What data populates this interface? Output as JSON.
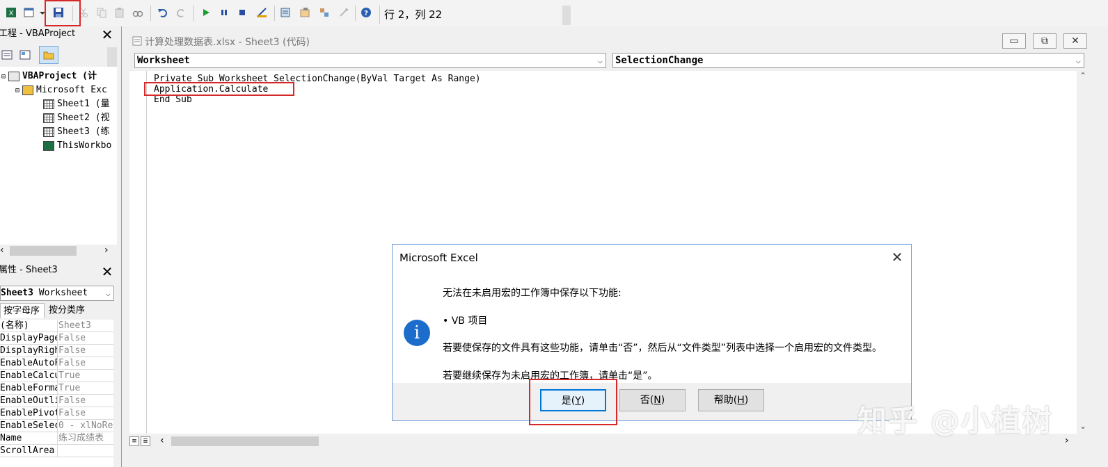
{
  "toolbar": {
    "position_text": "行 2，列 22",
    "icons": [
      "excel-icon",
      "insert-userform-icon",
      "save-icon",
      "cut-icon",
      "copy-icon",
      "paste-icon",
      "find-icon",
      "undo-icon",
      "redo-icon",
      "run-icon",
      "break-icon",
      "reset-icon",
      "design-mode-icon",
      "project-explorer-icon",
      "properties-icon",
      "object-browser-icon",
      "toolbox-icon",
      "help-icon"
    ]
  },
  "project": {
    "title": "工程 - VBAProject",
    "tree": [
      {
        "label": "VBAProject (计"
      },
      {
        "label": "Microsoft Exc"
      },
      {
        "label": "Sheet1 (量"
      },
      {
        "label": "Sheet2 (视"
      },
      {
        "label": "Sheet3 (练"
      },
      {
        "label": "ThisWorkbo"
      }
    ]
  },
  "properties": {
    "title": "属性 - Sheet3",
    "object_name": "Sheet3",
    "object_type": "Worksheet",
    "tabs": [
      "按字母序",
      "按分类序"
    ],
    "rows": [
      {
        "name": "(名称)",
        "value": "Sheet3"
      },
      {
        "name": "DisplayPage",
        "value": "False"
      },
      {
        "name": "DisplayRigh",
        "value": "False"
      },
      {
        "name": "EnableAutoF",
        "value": "False"
      },
      {
        "name": "EnableCalcu",
        "value": "True"
      },
      {
        "name": "EnableForma",
        "value": "True"
      },
      {
        "name": "EnableOutli",
        "value": "False"
      },
      {
        "name": "EnablePivot",
        "value": "False"
      },
      {
        "name": "EnableSelec",
        "value": "0 - xlNoRe"
      },
      {
        "name": "Name",
        "value": "练习成绩表"
      },
      {
        "name": "ScrollArea",
        "value": ""
      }
    ]
  },
  "code_window": {
    "title": "计算处理数据表.xlsx - Sheet3 (代码)",
    "object_combo": "Worksheet",
    "proc_combo": "SelectionChange",
    "lines": [
      "Private Sub Worksheet_SelectionChange(ByVal Target As Range)",
      "Application.Calculate",
      "End Sub"
    ]
  },
  "dialog": {
    "title": "Microsoft Excel",
    "line1": "无法在未启用宏的工作簿中保存以下功能:",
    "line2": "• VB 项目",
    "line3": "若要使保存的文件具有这些功能，请单击“否”，然后从“文件类型”列表中选择一个启用宏的文件类型。",
    "line4": "若要继续保存为未启用宏的工作簿，请单击“是”。",
    "btn_yes": "是(",
    "btn_yes_key": "Y",
    "btn_no": "否(",
    "btn_no_key": "N",
    "btn_help": "帮助(",
    "btn_help_key": "H",
    "btn_close": ")"
  },
  "watermark": "知乎 @小植树"
}
